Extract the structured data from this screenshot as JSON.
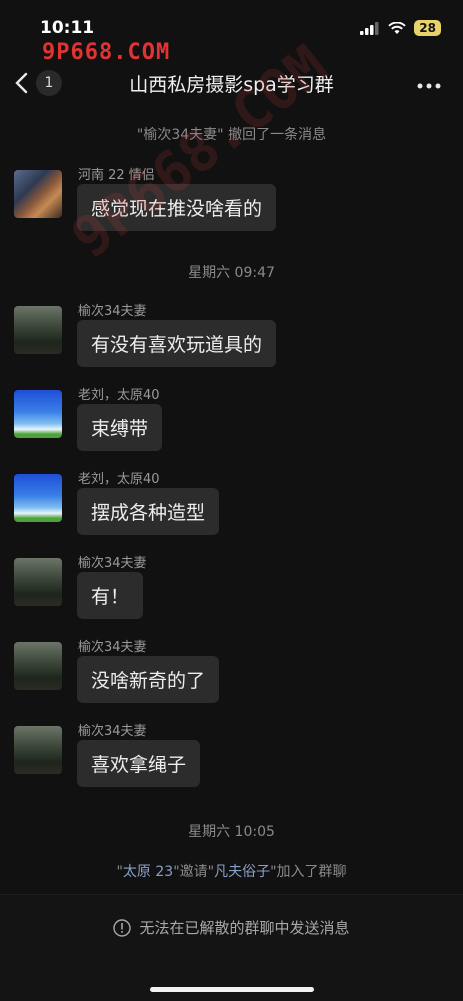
{
  "status": {
    "time": "10:11",
    "battery": "28"
  },
  "watermark": {
    "text": "9P668.COM",
    "diagonal": "9P668.COM"
  },
  "nav": {
    "back_badge": "1",
    "title": "山西私房摄影spa学习群"
  },
  "system_messages": {
    "recall": "\"榆次34夫妻\" 撤回了一条消息",
    "time1": "星期六 09:47",
    "time2": "星期六 10:05",
    "join": {
      "q1": "\"",
      "inviter": "太原 23",
      "mid": "\"邀请\"",
      "invitee": "凡夫俗子",
      "end": "\"加入了群聊"
    }
  },
  "messages": [
    {
      "sender": "河南  22  情侣",
      "text": "感觉现在推没啥看的",
      "avatar": "anime-avatar"
    },
    {
      "sender": "榆次34夫妻",
      "text": "有没有喜欢玩道具的",
      "avatar": "forest-avatar"
    },
    {
      "sender": "老刘，太原40",
      "text": "束缚带",
      "avatar": "sky-avatar"
    },
    {
      "sender": "老刘，太原40",
      "text": "摆成各种造型",
      "avatar": "sky-avatar"
    },
    {
      "sender": "榆次34夫妻",
      "text": "有！",
      "avatar": "forest-avatar"
    },
    {
      "sender": "榆次34夫妻",
      "text": "没啥新奇的了",
      "avatar": "forest-avatar"
    },
    {
      "sender": "榆次34夫妻",
      "text": "喜欢拿绳子",
      "avatar": "forest-avatar"
    }
  ],
  "footer": {
    "notice": "无法在已解散的群聊中发送消息"
  }
}
